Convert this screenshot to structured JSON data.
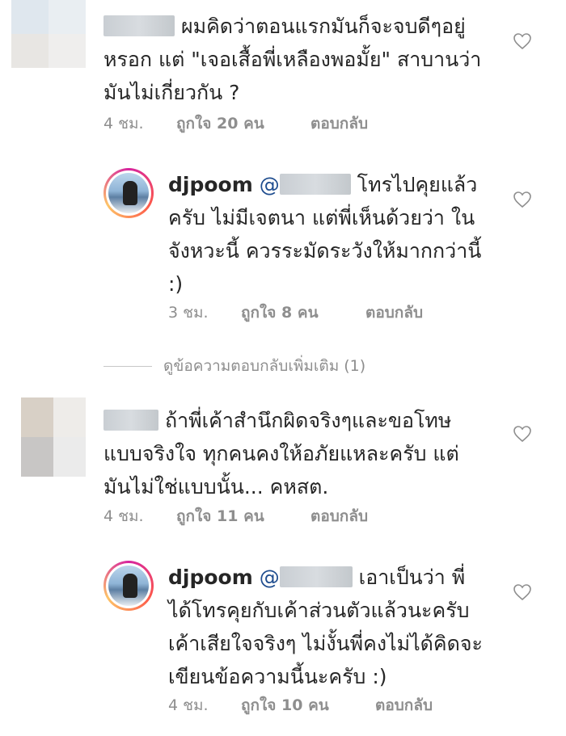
{
  "comments": [
    {
      "username_masked": "",
      "text": "ผมคิดว่าตอนแรกมันก็จะจบดีๆอยู่หรอก แต่ \"เจอเสื้อพี่เหลืองพอมั้ย\" สาบานว่ามันไม่เกี่ยวกัน ?",
      "time": "4 ชม.",
      "likes": "ถูกใจ 20 คน",
      "reply": "ตอบกลับ"
    },
    {
      "username": "djpoom",
      "mention_prefix": "@",
      "text": "โทรไปคุยแล้วครับ ไม่มีเจตนา แต่พี่เห็นด้วยว่า ในจังหวะนี้ ควรระมัดระวังให้มากกว่านี้ :)",
      "time": "3 ชม.",
      "likes": "ถูกใจ 8 คน",
      "reply": "ตอบกลับ"
    },
    {
      "more_replies": "ดูข้อความตอบกลับเพิ่มเติม (1)"
    },
    {
      "text": "ถ้าพี่เค้าสำนึกผิดจริงๆและขอโทษแบบจริงใจ ทุกคนคงให้อภัยแหละครับ แต่มันไม่ใช่แบบนั้น... คหสต.",
      "time": "4 ชม.",
      "likes": "ถูกใจ 11 คน",
      "reply": "ตอบกลับ"
    },
    {
      "username": "djpoom",
      "mention_prefix": "@",
      "text": "เอาเป็นว่า พี่ได้โทรคุยกับเค้าส่วนตัวแล้วนะครับ เค้าเสียใจจริงๆ ไม่งั้นพี่คงไม่ได้คิดจะเขียนข้อความนี้นะครับ :)",
      "time": "4 ชม.",
      "likes": "ถูกใจ 10 คน",
      "reply": "ตอบกลับ"
    }
  ],
  "colors": {
    "meta": "#8e8e8e",
    "text": "#262626",
    "mention": "#1f4d8f"
  },
  "icons": {
    "like": "heart-outline-icon"
  }
}
